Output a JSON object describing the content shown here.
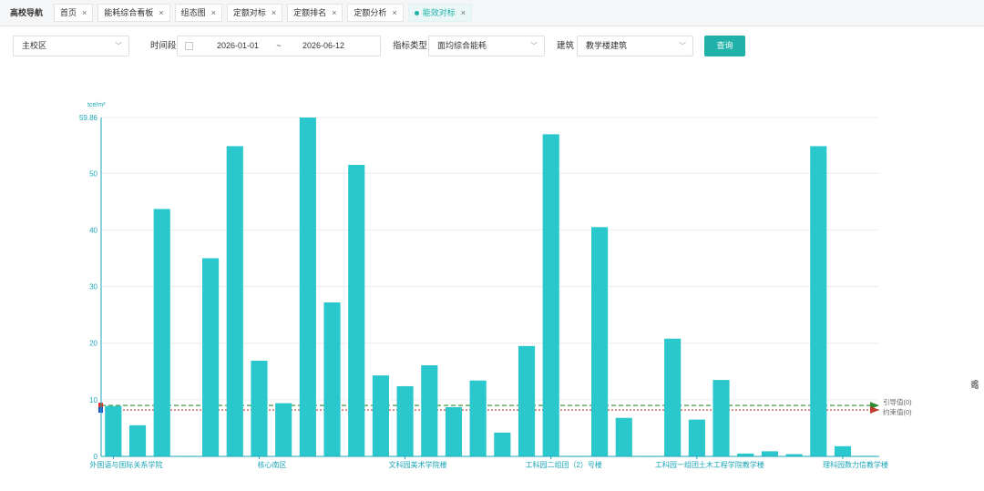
{
  "tabs": [
    {
      "label": "高校导航",
      "closable": false,
      "active": false
    },
    {
      "label": "首页",
      "closable": true,
      "active": false
    },
    {
      "label": "能耗综合看板",
      "closable": true,
      "active": false
    },
    {
      "label": "组态图",
      "closable": true,
      "active": false
    },
    {
      "label": "定额对标",
      "closable": true,
      "active": false
    },
    {
      "label": "定额排名",
      "closable": true,
      "active": false
    },
    {
      "label": "定额分析",
      "closable": true,
      "active": false
    },
    {
      "label": "能效对标",
      "closable": true,
      "active": true
    }
  ],
  "filters": {
    "campus": "主校区",
    "time_label": "时间段",
    "date_start": "2026-01-01",
    "date_sep": "~",
    "date_end": "2026-06-12",
    "indicator_label": "指标类型",
    "indicator_value": "面均综合能耗",
    "building_label": "建筑",
    "building_value": "教学楼建筑",
    "query_label": "查询"
  },
  "icons": {
    "close": "close-icon",
    "chevron": "chevron-down-icon",
    "calendar": "calendar-icon",
    "settings": "sliders-icon"
  },
  "colors": {
    "accent": "#20b2aa",
    "bar": "#2ac8cc",
    "guide_line": "#2e8b2e",
    "constraint_line": "#c0392b",
    "axis_text": "#1aa6b7"
  },
  "chart_data": {
    "type": "bar",
    "unit": "tce/m²",
    "ylim": [
      0,
      59.86
    ],
    "yticks": [
      0,
      10,
      20,
      30,
      40,
      50,
      59.86
    ],
    "x_tick_labels": [
      {
        "index": 0,
        "label": "外国语与国际关系学院"
      },
      {
        "index": 6,
        "label": "核心南区"
      },
      {
        "index": 12,
        "label": "文科园美术学院楼"
      },
      {
        "index": 18,
        "label": "工科园二组团（2）号楼"
      },
      {
        "index": 24,
        "label": "工科园一组团土木工程学院教学楼"
      },
      {
        "index": 30,
        "label": "理科园数力信教学楼"
      }
    ],
    "values": [
      8.9,
      5.5,
      43.7,
      0,
      35.0,
      54.8,
      16.9,
      9.4,
      59.86,
      27.2,
      51.5,
      14.3,
      12.4,
      16.1,
      8.7,
      13.4,
      4.2,
      19.5,
      56.9,
      0,
      40.5,
      6.8,
      0,
      20.8,
      6.5,
      13.5,
      0.5,
      0.9,
      0.4,
      54.8,
      1.8,
      0.1
    ],
    "reference_lines": [
      {
        "name": "引导值(0)",
        "value": 9.0,
        "color": "#2e8b2e"
      },
      {
        "name": "约束值(0)",
        "value": 8.2,
        "color": "#c0392b"
      }
    ],
    "grid": true,
    "legend": "none"
  }
}
